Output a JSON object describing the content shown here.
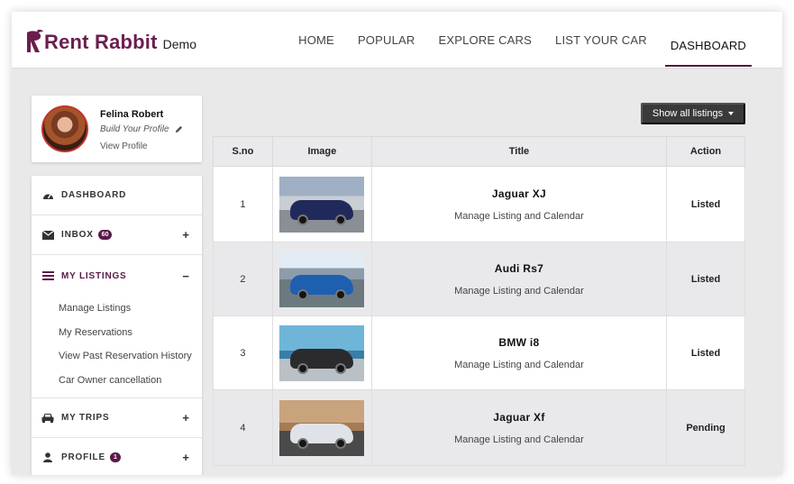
{
  "brand": {
    "name": "Rent Rabbit",
    "tag": "Demo",
    "color": "#6b1e4e"
  },
  "nav": [
    {
      "label": "HOME",
      "active": false
    },
    {
      "label": "POPULAR",
      "active": false
    },
    {
      "label": "EXPLORE CARS",
      "active": false
    },
    {
      "label": "LIST YOUR CAR",
      "active": false
    },
    {
      "label": "DASHBOARD",
      "active": true
    }
  ],
  "profile": {
    "name": "Felina Robert",
    "build_label": "Build Your Profile",
    "view_label": "View Profile"
  },
  "menu": {
    "dashboard": {
      "label": "DASHBOARD",
      "icon": "dashboard-gauge-icon"
    },
    "inbox": {
      "label": "INBOX",
      "badge": "60",
      "toggle": "+",
      "icon": "envelope-icon"
    },
    "listings": {
      "label": "MY LISTINGS",
      "toggle": "−",
      "icon": "list-icon",
      "items": [
        "Manage Listings",
        "My Reservations",
        "View Past Reservation History",
        "Car Owner cancellation"
      ]
    },
    "trips": {
      "label": "MY TRIPS",
      "toggle": "+",
      "icon": "car-icon"
    },
    "profile": {
      "label": "PROFILE",
      "badge": "1",
      "toggle": "+",
      "icon": "user-icon"
    }
  },
  "show_button": {
    "label": "Show all listings"
  },
  "table": {
    "headers": [
      "S.no",
      "Image",
      "Title",
      "Action"
    ],
    "rows": [
      {
        "sno": "1",
        "title": "Jaguar XJ",
        "sub": "Manage Listing and Calendar",
        "status": "Listed",
        "car_color": "#1f2a5a"
      },
      {
        "sno": "2",
        "title": "Audi Rs7",
        "sub": "Manage Listing and Calendar",
        "status": "Listed",
        "car_color": "#1f5fb0"
      },
      {
        "sno": "3",
        "title": "BMW i8",
        "sub": "Manage Listing and Calendar",
        "status": "Listed",
        "car_color": "#2b2b2e"
      },
      {
        "sno": "4",
        "title": "Jaguar Xf",
        "sub": "Manage Listing and Calendar",
        "status": "Pending",
        "car_color": "#dfe2e6"
      }
    ]
  }
}
